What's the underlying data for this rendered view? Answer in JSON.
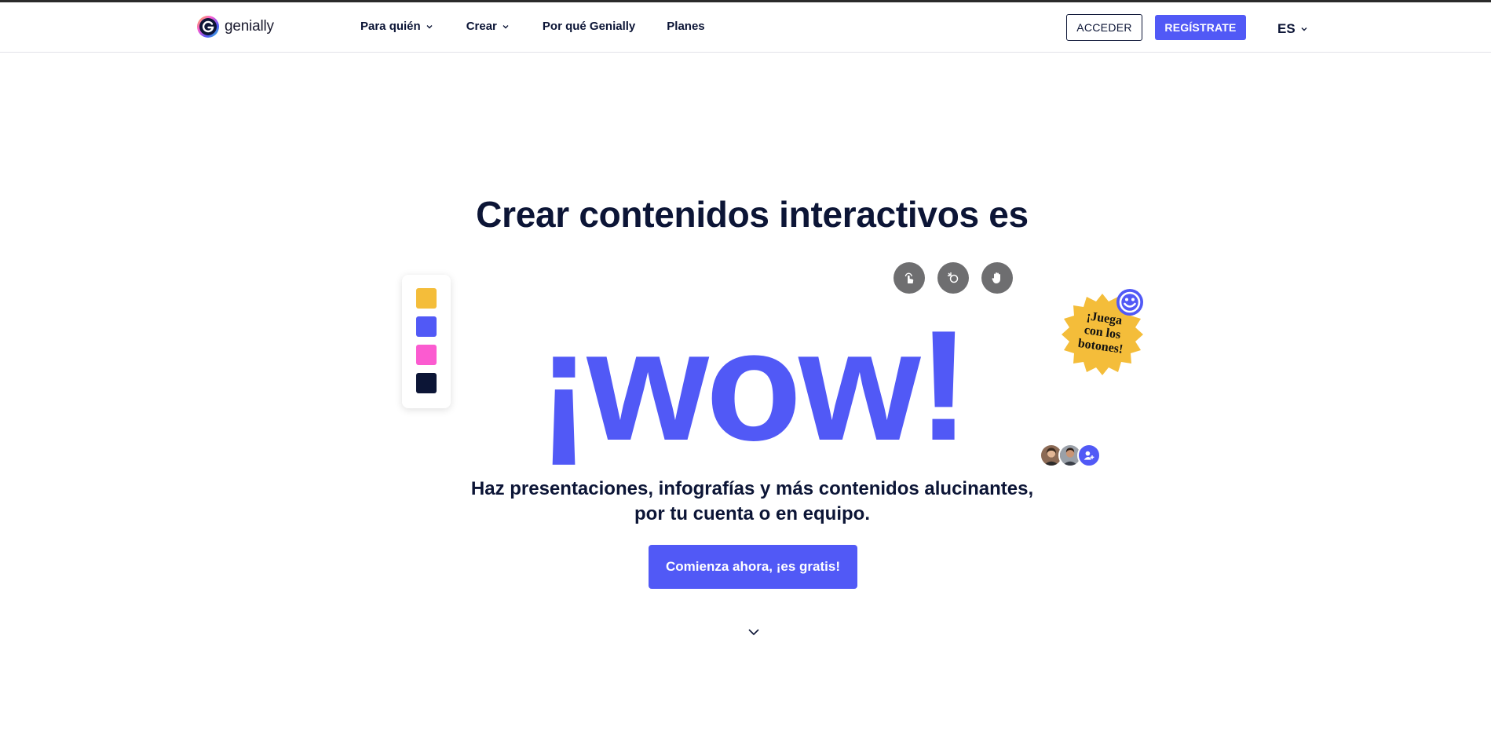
{
  "header": {
    "logo_text": "genially",
    "nav": [
      {
        "label": "Para quién",
        "has_dropdown": true
      },
      {
        "label": "Crear",
        "has_dropdown": true
      },
      {
        "label": "Por qué Genially",
        "has_dropdown": false
      },
      {
        "label": "Planes",
        "has_dropdown": false
      }
    ],
    "acceder_label": "ACCEDER",
    "registrate_label": "REGÍSTRATE",
    "language": "ES"
  },
  "hero": {
    "title": "Crear contenidos interactivos es",
    "wow": "¡wow!",
    "subtitle_line1": "Haz presentaciones, infografías y más contenidos alucinantes,",
    "subtitle_line2": "por tu cuenta o en equipo.",
    "cta_label": "Comienza ahora, ¡es gratis!",
    "sticker_line1": "¡Juega",
    "sticker_line2": "con los",
    "sticker_line3": "botones!",
    "palette_colors": [
      "#f4bd3a",
      "#5159f6",
      "#fb5bd0",
      "#0c1536"
    ],
    "tool_icons": [
      "tap-icon",
      "cursor-click-icon",
      "hand-icon"
    ]
  },
  "colors": {
    "brand": "#5159f6",
    "text_dark": "#0c1536",
    "sticker_yellow": "#f4bd3a"
  }
}
